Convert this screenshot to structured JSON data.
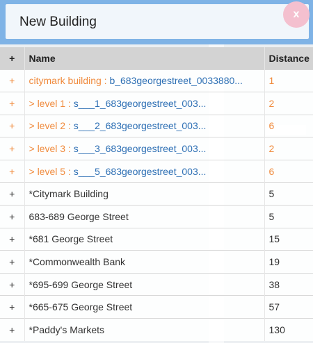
{
  "dialog": {
    "title": "New Building",
    "close_label": "x"
  },
  "table": {
    "headers": {
      "add": "+",
      "name": "Name",
      "distance": "Distance"
    },
    "rows": [
      {
        "add": "+",
        "name_prefix": "citymark building : ",
        "name_code": "b_683georgestreet_0033880...",
        "distance": "1",
        "highlighted": true
      },
      {
        "add": "+",
        "name_prefix": "> level 1 : ",
        "name_code": "s___1_683georgestreet_003...",
        "distance": "2",
        "highlighted": true
      },
      {
        "add": "+",
        "name_prefix": "> level 2 : ",
        "name_code": "s___2_683georgestreet_003...",
        "distance": "6",
        "highlighted": true
      },
      {
        "add": "+",
        "name_prefix": "> level 3 : ",
        "name_code": "s___3_683georgestreet_003...",
        "distance": "2",
        "highlighted": true
      },
      {
        "add": "+",
        "name_prefix": "> level 5 : ",
        "name_code": "s___5_683georgestreet_003...",
        "distance": "6",
        "highlighted": true
      },
      {
        "add": "+",
        "name_prefix": "*Citymark Building",
        "name_code": "",
        "distance": "5",
        "highlighted": false
      },
      {
        "add": "+",
        "name_prefix": "683-689 George Street",
        "name_code": "",
        "distance": "5",
        "highlighted": false
      },
      {
        "add": "+",
        "name_prefix": "*681 George Street",
        "name_code": "",
        "distance": "15",
        "highlighted": false
      },
      {
        "add": "+",
        "name_prefix": "*Commonwealth Bank",
        "name_code": "",
        "distance": "19",
        "highlighted": false
      },
      {
        "add": "+",
        "name_prefix": "*695-699 George Street",
        "name_code": "",
        "distance": "38",
        "highlighted": false
      },
      {
        "add": "+",
        "name_prefix": "*665-675 George Street",
        "name_code": "",
        "distance": "57",
        "highlighted": false
      },
      {
        "add": "+",
        "name_prefix": "*Paddy's Markets",
        "name_code": "",
        "distance": "130",
        "highlighted": false
      }
    ]
  },
  "colors": {
    "header_bg": "#7fb3e6",
    "highlight_text": "#f08a3c",
    "code_text": "#2d6fb4",
    "close_button": "#f4c0cf"
  }
}
